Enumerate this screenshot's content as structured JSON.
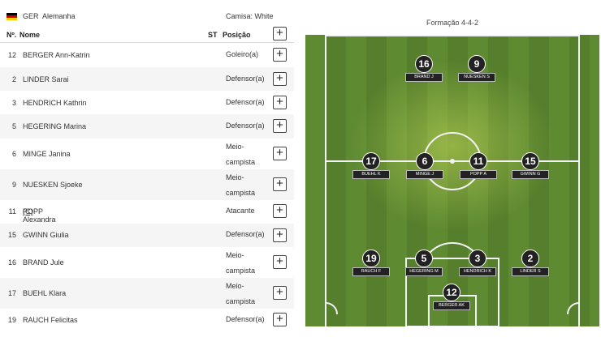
{
  "team": {
    "code": "GER",
    "name": "Alemanha",
    "shirt": "Camisa: White",
    "flag_colors": [
      "#000000",
      "#dd0000",
      "#ffce00"
    ]
  },
  "columns": {
    "number": "Nº.",
    "name": "Nome",
    "st": "ST",
    "position": "Posição",
    "add": "+"
  },
  "players": [
    {
      "number": "12",
      "name": "BERGER Ann-Katrin",
      "captain": "",
      "position": "Goleiro(a)",
      "add": "+"
    },
    {
      "number": "2",
      "name": "LINDER Sarai",
      "captain": "",
      "position": "Defensor(a)",
      "add": "+"
    },
    {
      "number": "3",
      "name": "HENDRICH Kathrin",
      "captain": "",
      "position": "Defensor(a)",
      "add": "+"
    },
    {
      "number": "5",
      "name": "HEGERING Marina",
      "captain": "",
      "position": "Defensor(a)",
      "add": "+"
    },
    {
      "number": "6",
      "name": "MINGE Janina",
      "captain": "",
      "position": "Meio-campista",
      "add": "+"
    },
    {
      "number": "9",
      "name": "NUESKEN Sjoeke",
      "captain": "",
      "position": "Meio-campista",
      "add": "+"
    },
    {
      "number": "11",
      "name": "POPP Alexandra",
      "captain": "(C)",
      "position": "Atacante",
      "add": "+"
    },
    {
      "number": "15",
      "name": "GWINN Giulia",
      "captain": "",
      "position": "Defensor(a)",
      "add": "+"
    },
    {
      "number": "16",
      "name": "BRAND Jule",
      "captain": "",
      "position": "Meio-campista",
      "add": "+"
    },
    {
      "number": "17",
      "name": "BUEHL Klara",
      "captain": "",
      "position": "Meio-campista",
      "add": "+"
    },
    {
      "number": "19",
      "name": "RAUCH Felicitas",
      "captain": "",
      "position": "Defensor(a)",
      "add": "+"
    }
  ],
  "formation": {
    "title": "Formação 4-4-2",
    "players": [
      {
        "number": "16",
        "label": "BRAND J"
      },
      {
        "number": "9",
        "label": "NUESKEN S"
      },
      {
        "number": "17",
        "label": "BUEHL K"
      },
      {
        "number": "6",
        "label": "MINGE J"
      },
      {
        "number": "11",
        "label": "POPP A"
      },
      {
        "number": "15",
        "label": "GWINN G"
      },
      {
        "number": "19",
        "label": "RAUCH F"
      },
      {
        "number": "5",
        "label": "HEGERING M"
      },
      {
        "number": "3",
        "label": "HENDRICH K"
      },
      {
        "number": "2",
        "label": "LINDER S"
      },
      {
        "number": "12",
        "label": "BERGER AK"
      }
    ]
  }
}
